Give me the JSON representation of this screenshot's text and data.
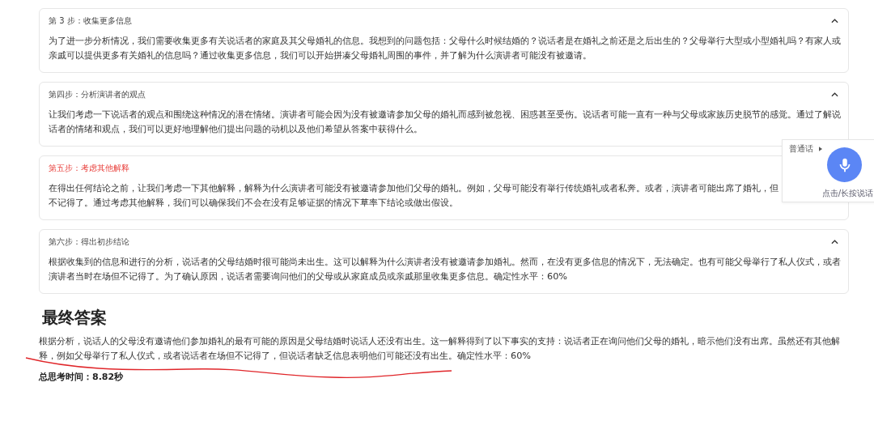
{
  "steps": [
    {
      "title": "第 3 步：收集更多信息",
      "highlighted": false,
      "expanded": true,
      "lines": [
        "为了进一步分析情况，我们需要收集更多有关说话者的家庭及其父母婚礼的信息。我想到的问题包括：父母什么时候结婚的？说话者是在婚礼之前还是之后出生的？父母举行大型或小型婚礼吗？有家人或",
        "亲戚可以提供更多有关婚礼的信息吗？通过收集更多信息，我们可以开始拼凑父母婚礼周围的事件，并了解为什么演讲者可能没有被邀请。"
      ]
    },
    {
      "title": "第四步：分析演讲者的观点",
      "highlighted": false,
      "expanded": true,
      "lines": [
        "让我们考虑一下说话者的观点和围绕这种情况的潜在情绪。演讲者可能会因为没有被邀请参加父母的婚礼而感到被忽视、困惑甚至受伤。说话者可能一直有一种与父母或家族历史脱节的感觉。通过了解说",
        "话者的情绪和观点，我们可以更好地理解他们提出问题的动机以及他们希望从答案中获得什么。"
      ]
    },
    {
      "title": "第五步：考虑其他解释",
      "highlighted": true,
      "lines": [
        "在得出任何结论之前，让我们考虑一下其他解释，解释为什么演讲者可能没有被邀请参加他们父母的婚礼。例如，父母可能没有举行传统婚礼或者私奔。或者，演讲者可能出席了婚礼，但",
        "不记得了。通过考虑其他解释，我们可以确保我们不会在没有足够证据的情况下草率下结论或做出假设。"
      ]
    },
    {
      "title": "第六步：得出初步结论",
      "highlighted": false,
      "expanded": true,
      "lines": [
        "根据收集到的信息和进行的分析，说话者的父母结婚时很可能尚未出生。这可以解释为什么演讲者没有被邀请参加婚礼。然而，在没有更多信息的情况下，无法确定。也有可能父母举行了私人仪式，或者",
        "演讲者当时在场但不记得了。为了确认原因，说话者需要询问他们的父母或从家庭成员或亲戚那里收集更多信息。确定性水平：60%"
      ]
    }
  ],
  "final_answer": {
    "heading": "最终答案",
    "lines": [
      "根据分析，说话人的父母没有邀请他们参加婚礼的最有可能的原因是父母结婚时说话人还没有出生。这一解释得到了以下事实的支持：说话者正在询问他们父母的婚礼，暗示他们没有出席。虽然还有其他解",
      "释，例如父母举行了私人仪式，或者说话者在场但不记得了，但说话者缺乏信息表明他们可能还没有出生。确定性水平：60%"
    ],
    "thinking_time": "总思考时间：8.82秒"
  },
  "voice_widget": {
    "language": "普通话",
    "hint": "点击/长按说话"
  },
  "annotation": {
    "kind": "underline"
  }
}
